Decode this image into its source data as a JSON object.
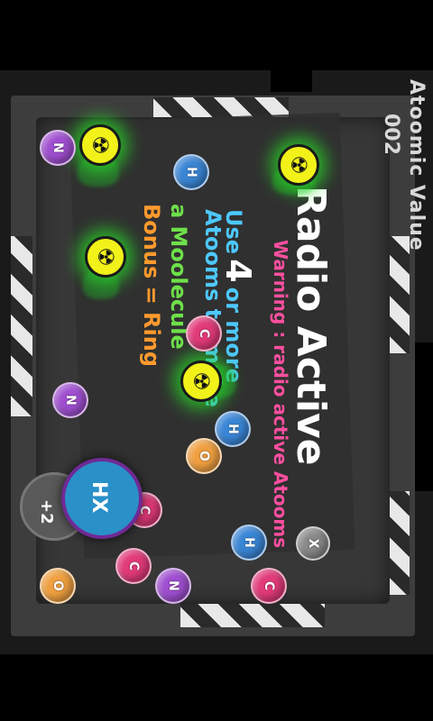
{
  "hud": {
    "score_label": "Atoomic Value",
    "score_value": "002"
  },
  "instructions": {
    "title": "Radio Active",
    "warning": "Warning : radio active Atooms",
    "use_prefix": "Use",
    "use_count": "4",
    "use_suffix": "or more",
    "line_atooms": "Atooms to make",
    "line_molecule": "a Moolecule",
    "line_bonus": "Bonus = Ring"
  },
  "controls": {
    "bonus_count": "+2",
    "hx_label": "HX"
  },
  "atoms": [
    {
      "id": "n-top-left",
      "symbol": "N",
      "color": "#a04fd0"
    },
    {
      "id": "h-top",
      "symbol": "H",
      "color": "#3a86d6"
    },
    {
      "id": "c-mid",
      "symbol": "C",
      "color": "#e23a7a"
    },
    {
      "id": "n-mid-left",
      "symbol": "N",
      "color": "#a04fd0"
    },
    {
      "id": "h-mid",
      "symbol": "H",
      "color": "#3a86d6"
    },
    {
      "id": "o-mid",
      "symbol": "O",
      "color": "#f0a040"
    },
    {
      "id": "c-lower",
      "symbol": "C",
      "color": "#e23a7a"
    },
    {
      "id": "h-lower",
      "symbol": "H",
      "color": "#3a86d6"
    },
    {
      "id": "x-right",
      "symbol": "X",
      "color": "#8a8a8a"
    },
    {
      "id": "c-bottom-a",
      "symbol": "C",
      "color": "#e23a7a"
    },
    {
      "id": "n-bottom",
      "symbol": "N",
      "color": "#a04fd0"
    },
    {
      "id": "c-bottom-b",
      "symbol": "C",
      "color": "#e23a7a"
    },
    {
      "id": "o-bottom",
      "symbol": "O",
      "color": "#f0a040"
    }
  ],
  "colors": {
    "radioactive": "#f2f21a",
    "glow": "#28dc28",
    "blue_button": "#2a90c8",
    "button_ring": "#6f2a95"
  }
}
